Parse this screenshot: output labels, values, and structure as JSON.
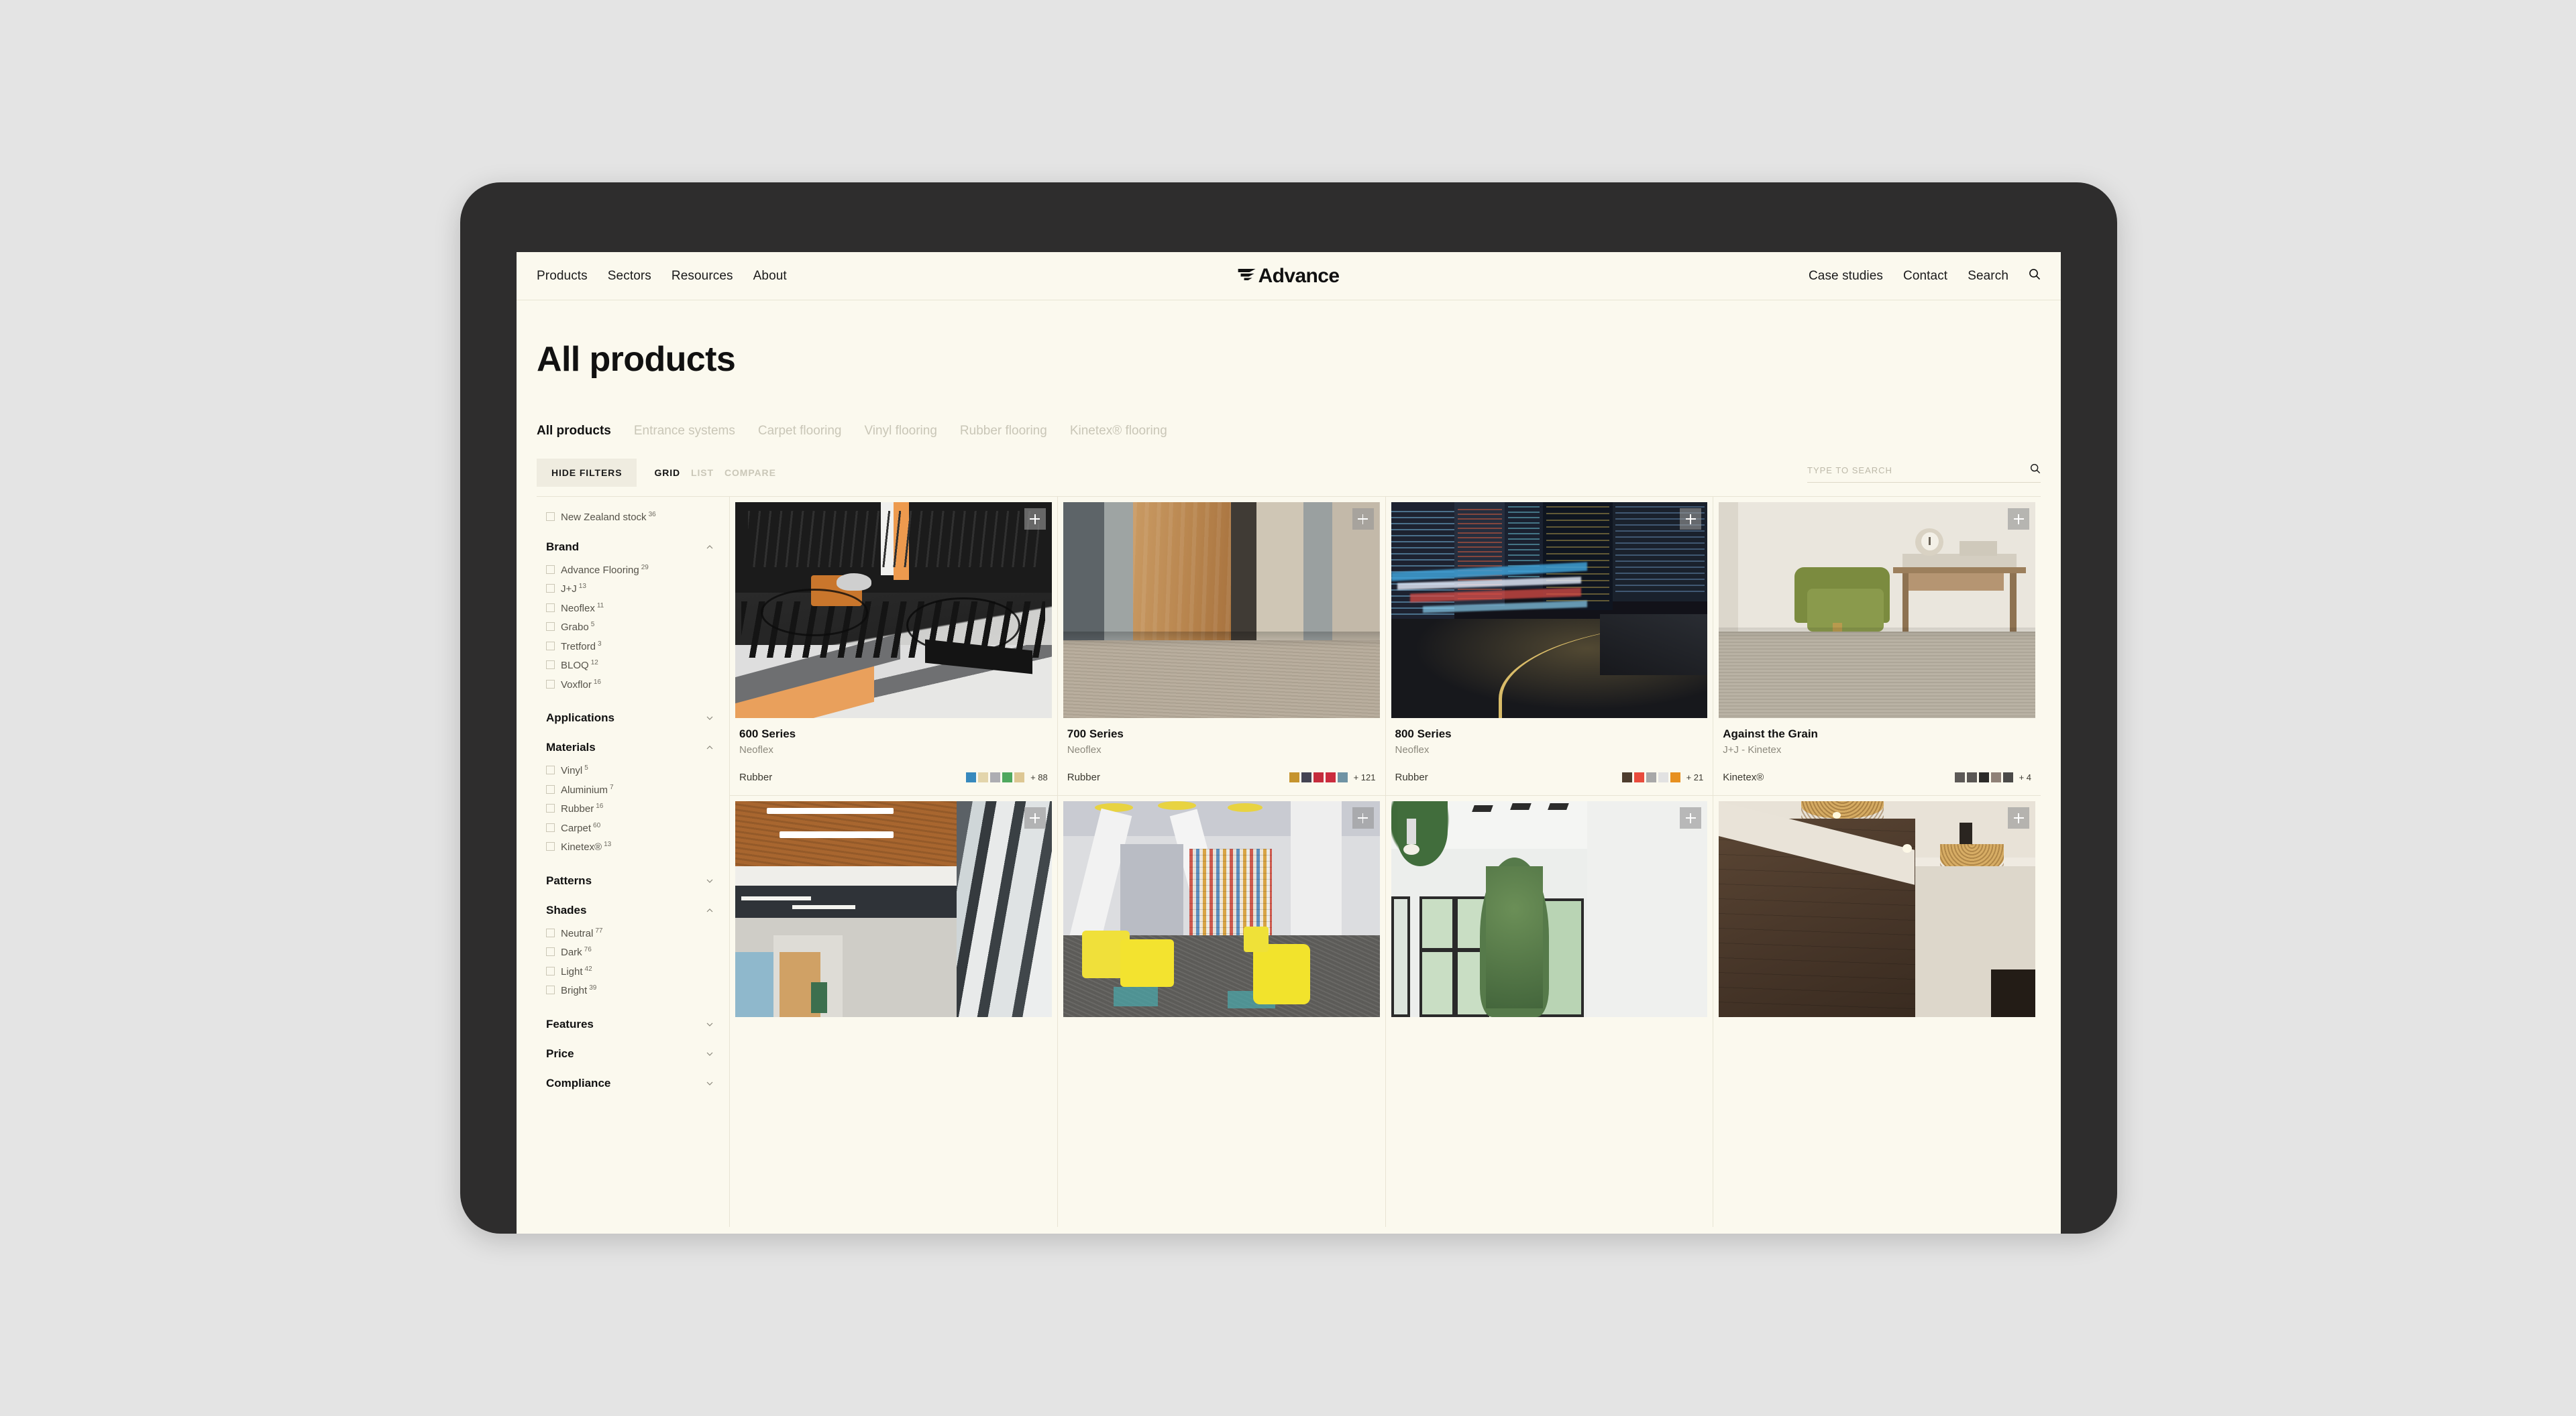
{
  "topnav": {
    "left_links": [
      "Products",
      "Sectors",
      "Resources",
      "About"
    ],
    "brand": "Advance",
    "right_links": [
      "Case studies",
      "Contact",
      "Search"
    ],
    "search_icon": "search-icon"
  },
  "page": {
    "title": "All products"
  },
  "category_tabs": [
    {
      "label": "All products",
      "active": true
    },
    {
      "label": "Entrance systems",
      "active": false
    },
    {
      "label": "Carpet flooring",
      "active": false
    },
    {
      "label": "Vinyl flooring",
      "active": false
    },
    {
      "label": "Rubber flooring",
      "active": false
    },
    {
      "label": "Kinetex® flooring",
      "active": false
    }
  ],
  "toolbar": {
    "hide_filters_label": "HIDE FILTERS",
    "view_modes": [
      {
        "label": "GRID",
        "active": true
      },
      {
        "label": "LIST",
        "active": false
      },
      {
        "label": "COMPARE",
        "active": false
      }
    ],
    "search_placeholder": "TYPE TO SEARCH",
    "search_value": ""
  },
  "sidebar": {
    "standalone": [
      {
        "label": "New Zealand stock",
        "count": "36",
        "checked": false
      }
    ],
    "groups": [
      {
        "title": "Brand",
        "expanded": true,
        "options": [
          {
            "label": "Advance Flooring",
            "count": "29",
            "checked": false
          },
          {
            "label": "J+J",
            "count": "13",
            "checked": false
          },
          {
            "label": "Neoflex",
            "count": "11",
            "checked": false
          },
          {
            "label": "Grabo",
            "count": "5",
            "checked": false
          },
          {
            "label": "Tretford",
            "count": "3",
            "checked": false
          },
          {
            "label": "BLOQ",
            "count": "12",
            "checked": false
          },
          {
            "label": "Voxflor",
            "count": "16",
            "checked": false
          }
        ]
      },
      {
        "title": "Applications",
        "expanded": false,
        "options": []
      },
      {
        "title": "Materials",
        "expanded": true,
        "options": [
          {
            "label": "Vinyl",
            "count": "5",
            "checked": false
          },
          {
            "label": "Aluminium",
            "count": "7",
            "checked": false
          },
          {
            "label": "Rubber",
            "count": "16",
            "checked": false
          },
          {
            "label": "Carpet",
            "count": "60",
            "checked": false
          },
          {
            "label": "Kinetex®",
            "count": "13",
            "checked": false
          }
        ]
      },
      {
        "title": "Patterns",
        "expanded": false,
        "options": []
      },
      {
        "title": "Shades",
        "expanded": true,
        "options": [
          {
            "label": "Neutral",
            "count": "77",
            "checked": false
          },
          {
            "label": "Dark",
            "count": "76",
            "checked": false
          },
          {
            "label": "Light",
            "count": "42",
            "checked": false
          },
          {
            "label": "Bright",
            "count": "39",
            "checked": false
          }
        ]
      },
      {
        "title": "Features",
        "expanded": false,
        "options": []
      },
      {
        "title": "Price",
        "expanded": false,
        "options": []
      },
      {
        "title": "Compliance",
        "expanded": false,
        "options": []
      }
    ]
  },
  "products": [
    {
      "title": "600 Series",
      "brand": "Neoflex",
      "material": "Rubber",
      "swatches": [
        "#3789bd",
        "#e3d5ab",
        "#adadb2",
        "#4fa85e",
        "#ddc793"
      ],
      "more": "+ 88",
      "image": "bike-storage-room",
      "add_button": "add-to-compare"
    },
    {
      "title": "700 Series",
      "brand": "Neoflex",
      "material": "Rubber",
      "swatches": [
        "#c6942e",
        "#444453",
        "#c52c3c",
        "#cb2c3e",
        "#6f93a4"
      ],
      "more": "+ 121",
      "image": "office-corridor-carpet",
      "add_button": "add-to-compare"
    },
    {
      "title": "800 Series",
      "brand": "Neoflex",
      "material": "Rubber",
      "swatches": [
        "#4e3d2e",
        "#e94b3c",
        "#a8a8a8",
        "#e2e2e2",
        "#e79020"
      ],
      "more": "+ 21",
      "image": "city-night-street",
      "add_button": "add-to-compare"
    },
    {
      "title": "Against the Grain",
      "brand": "J+J - Kinetex",
      "material": "Kinetex®",
      "swatches": [
        "#5d5a57",
        "#5a5754",
        "#2c2b29",
        "#8f8177",
        "#4b4a48"
      ],
      "more": "+ 4",
      "image": "office-green-chair-desk",
      "add_button": "add-to-compare"
    }
  ],
  "products_row2": [
    {
      "image": "library-glass-interior",
      "add_button": "add-to-compare"
    },
    {
      "image": "library-yellow-seats",
      "add_button": "add-to-compare"
    },
    {
      "image": "bright-room-windows-trees",
      "add_button": "add-to-compare"
    },
    {
      "image": "dark-wood-wall-pendants",
      "add_button": "add-to-compare"
    }
  ],
  "colors": {
    "page_background": "#fbf9ee",
    "outer_background": "#e4e4e4",
    "device_frame": "#2e2d2d",
    "divider": "#e8e4d4",
    "muted_text": "#c9c6b7",
    "filter_button_bg": "#efece0"
  }
}
